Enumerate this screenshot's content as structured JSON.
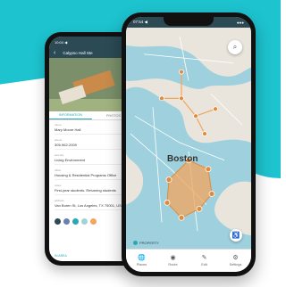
{
  "back_phone": {
    "status_left": "10:04 ◀",
    "status_right": "●●●",
    "header_title": "Calypso Hall Ste",
    "tabs": [
      "INFORMATION",
      "PHOTOS"
    ],
    "fields": [
      {
        "label": "name",
        "value": "Mary Moore Hall"
      },
      {
        "label": "phone",
        "value": "305-962-2009"
      },
      {
        "label": "amenity",
        "value": "Living Environment"
      },
      {
        "label": "office",
        "value": "Housing & Residential Programs Office"
      },
      {
        "label": "notes",
        "value": "First-year students. Returning students"
      },
      {
        "label": "address",
        "value": "Van Buren St, Los Angeles, TX 75001, USA"
      }
    ],
    "dot_colors": [
      "#2b4a54",
      "#6a7fb0",
      "#2aa7b3",
      "#9fd3d9",
      "#f2a55c"
    ],
    "bottom_label": "IN AREA"
  },
  "front_phone": {
    "status_left": "07:54 ◀",
    "status_right": "●●●",
    "city_label": "Boston",
    "brand": "PROPERTY",
    "nav": [
      {
        "icon": "globe-icon",
        "glyph": "🌐",
        "label": "Places"
      },
      {
        "icon": "pin-icon",
        "glyph": "◉",
        "label": "Route"
      },
      {
        "icon": "pencil-icon",
        "glyph": "✎",
        "label": "Edit"
      },
      {
        "icon": "gear-icon",
        "glyph": "⚙",
        "label": "Settings"
      }
    ]
  },
  "colors": {
    "teal": "#1dc3cf",
    "accent": "#2aa7b3",
    "polygon": "#f2a55c",
    "water": "#9fd0de"
  }
}
